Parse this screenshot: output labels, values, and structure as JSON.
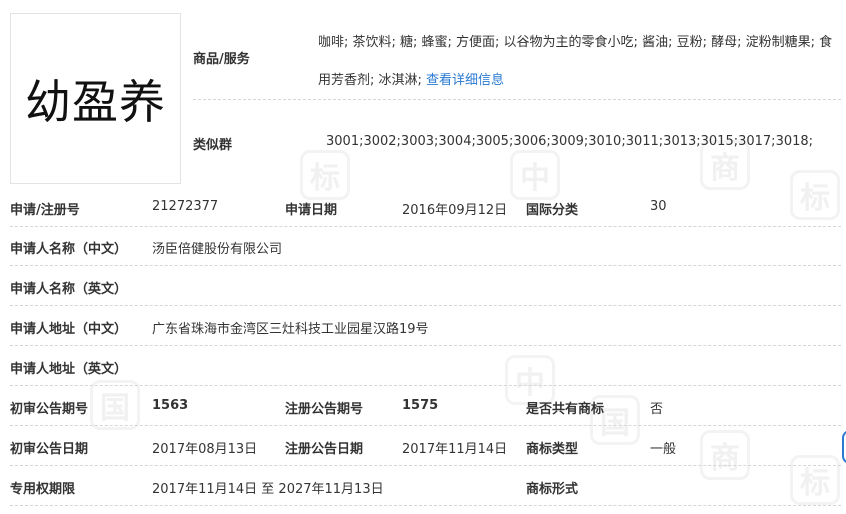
{
  "logo": {
    "text": "幼盈养"
  },
  "goods": {
    "label": "商品/服务",
    "items": "咖啡; 茶饮料; 糖; 蜂蜜; 方便面; 以谷物为主的零食小吃; 酱油; 豆粉; 酵母; 淀粉制糖果; 食用芳香剂; 冰淇淋;",
    "detail_link": "查看详细信息"
  },
  "similar_group": {
    "label": "类似群",
    "value": "3001;3002;3003;3004;3005;3006;3009;3010;3011;3013;3015;3017;3018;"
  },
  "rows": {
    "reg_no": {
      "label": "申请/注册号",
      "value": "21272377"
    },
    "apply_date": {
      "label": "申请日期",
      "value": "2016年09月12日"
    },
    "intl_class": {
      "label": "国际分类",
      "value": "30"
    },
    "applicant_cn": {
      "label": "申请人名称（中文）",
      "value": "汤臣倍健股份有限公司"
    },
    "applicant_en": {
      "label": "申请人名称（英文）",
      "value": ""
    },
    "address_cn": {
      "label": "申请人地址（中文）",
      "value": "广东省珠海市金湾区三灶科技工业园星汉路19号"
    },
    "address_en": {
      "label": "申请人地址（英文）",
      "value": ""
    },
    "prelim_issue": {
      "label": "初审公告期号",
      "value": "1563"
    },
    "reg_issue": {
      "label": "注册公告期号",
      "value": "1575"
    },
    "shared": {
      "label": "是否共有商标",
      "value": "否"
    },
    "prelim_date": {
      "label": "初审公告日期",
      "value": "2017年08月13日"
    },
    "reg_date": {
      "label": "注册公告日期",
      "value": "2017年11月14日"
    },
    "mark_type": {
      "label": "商标类型",
      "value": "一般"
    },
    "exclusive_period": {
      "label": "专用权期限",
      "value": "2017年11月14日 至 2027年11月13日"
    },
    "mark_form": {
      "label": "商标形式",
      "value": ""
    }
  },
  "watermark": {
    "glyphs": [
      "中",
      "国",
      "商",
      "标"
    ]
  }
}
